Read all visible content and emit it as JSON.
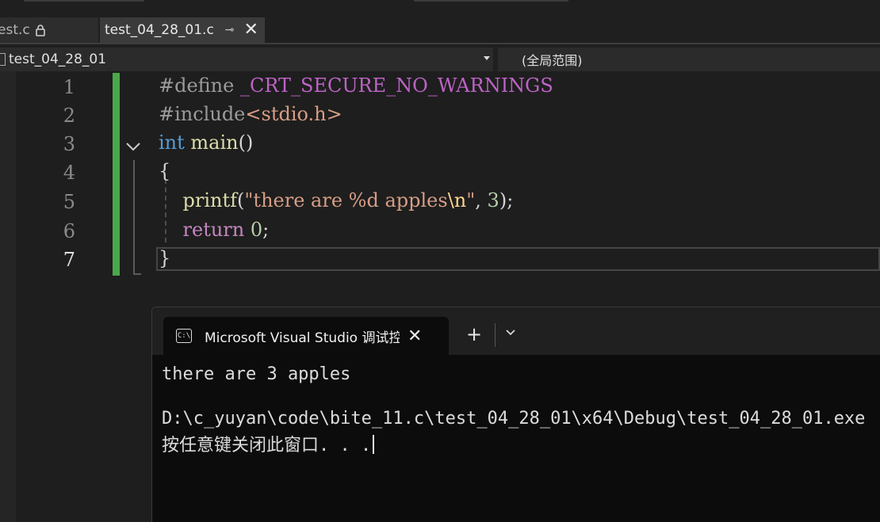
{
  "tabs": [
    {
      "label": "est.c",
      "locked": true
    },
    {
      "label": "test_04_28_01.c",
      "pin": "⊸",
      "close": "✕"
    }
  ],
  "navbar": {
    "project": "test_04_28_01",
    "scope": "(全局范围)"
  },
  "editor": {
    "line_numbers": [
      "1",
      "2",
      "3",
      "4",
      "5",
      "6",
      "7"
    ],
    "current_line": 7
  },
  "terminal": {
    "tab_title": "Microsoft Visual Studio 调试控制台",
    "tab_close": "✕",
    "new_tab": "+",
    "output": [
      "there are 3 apples",
      "",
      "D:\\c_yuyan\\code\\bite_11.c\\test_04_28_01\\x64\\Debug\\test_04_28_01.exe",
      "按任意键关闭此窗口. . ."
    ]
  },
  "colors": {
    "keyword": "#569cd6",
    "function": "#dcdcaa",
    "string": "#d69d85",
    "number": "#b5cea8",
    "change_bar": "#4aa84a"
  }
}
